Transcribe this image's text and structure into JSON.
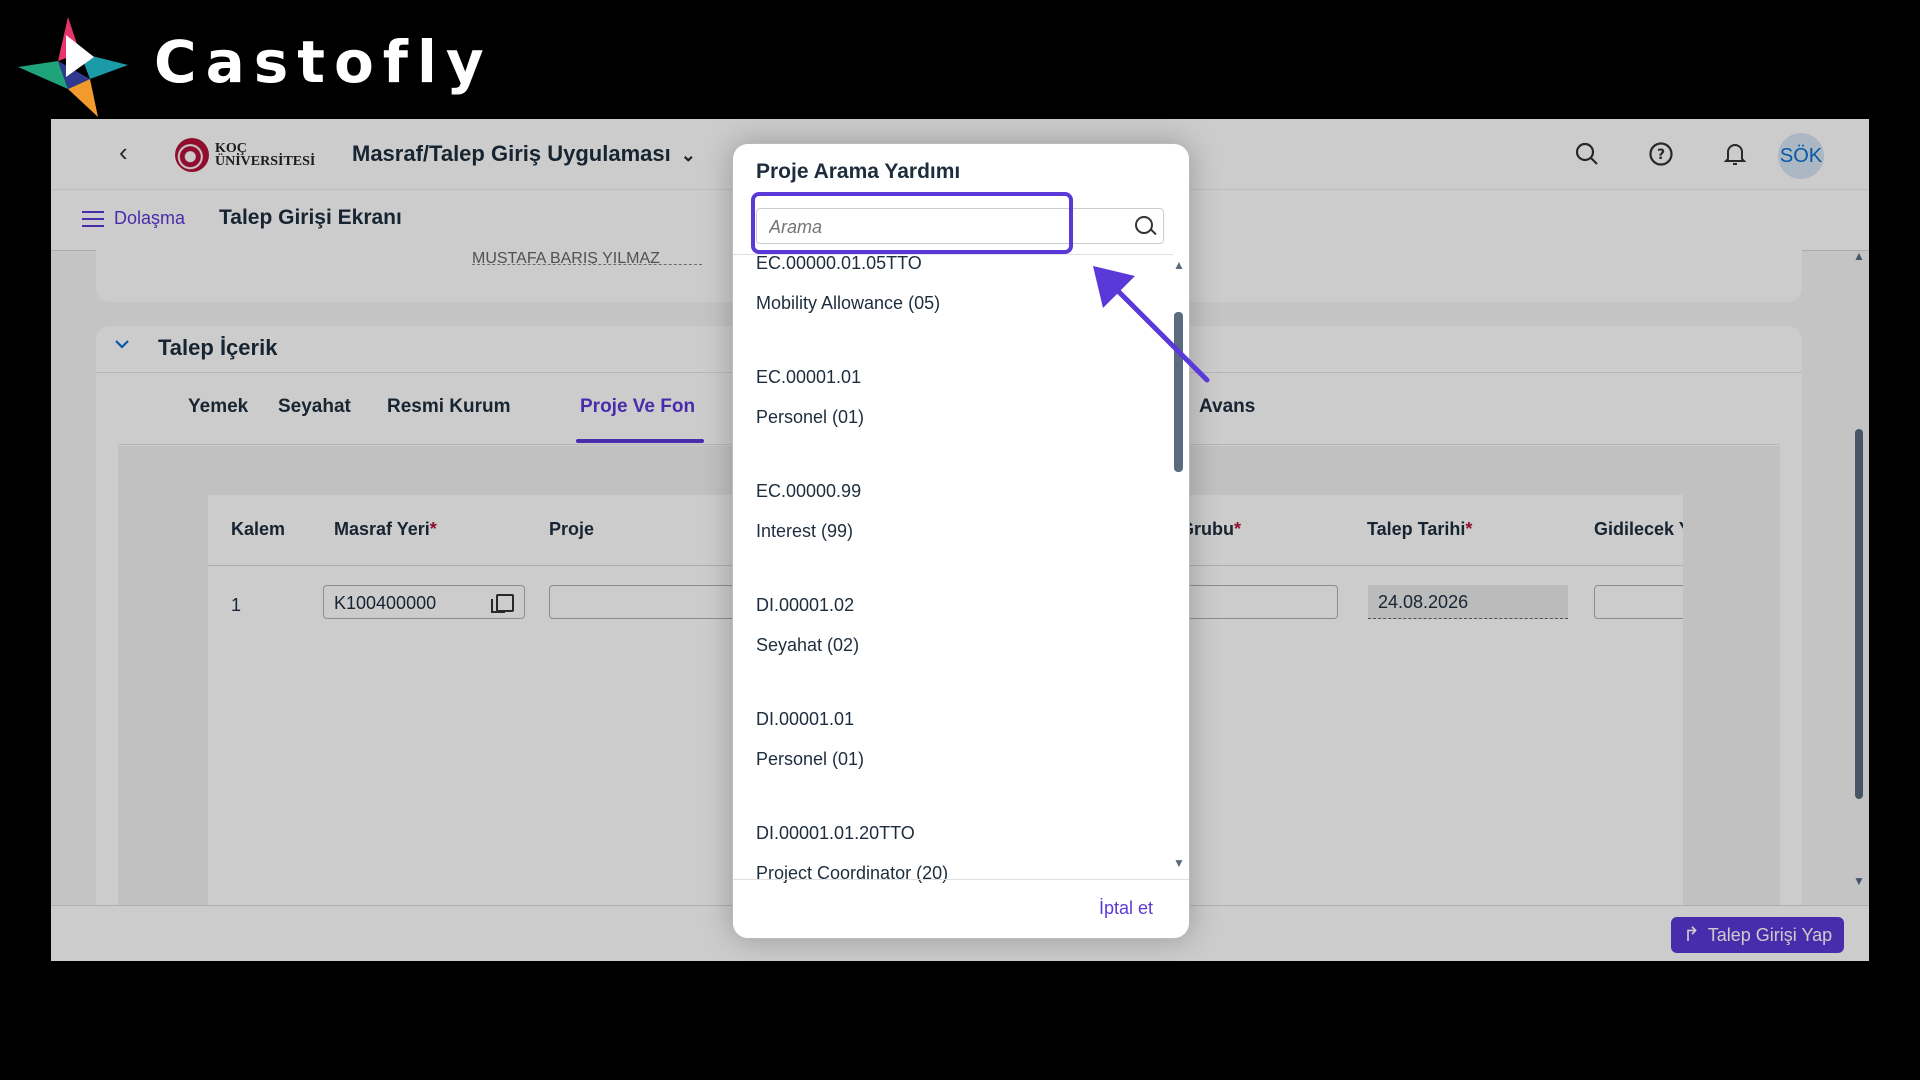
{
  "brand": {
    "name": "Castofly"
  },
  "header": {
    "logo_line1": "KOÇ",
    "logo_line2": "ÜNİVERSİTESİ",
    "app_title": "Masraf/Talep Giriş Uygulaması",
    "avatar_initials": "SÖK"
  },
  "subheader": {
    "nav_label": "Dolaşma",
    "page_title": "Talep Girişi Ekranı"
  },
  "section": {
    "title": "Talep İçerik",
    "ghost_text": "MUSTAFA BARIŞ YILMAZ (DİR...)",
    "tabs": [
      "Yemek",
      "Seyahat",
      "Resmi Kurum",
      "Proje Ve Fon",
      "Avans"
    ],
    "active_tab": "Proje Ve Fon"
  },
  "table": {
    "columns": [
      "Kalem",
      "Masraf Yeri",
      "Proje",
      "Grubu",
      "Talep Tarihi",
      "Gidilecek Y"
    ],
    "required_mark": "*",
    "row": {
      "kalem": "1",
      "masraf_yeri": "K100400000",
      "talep_tarihi": "24.08.2026"
    }
  },
  "footer": {
    "submit_label": "Talep Girişi Yap"
  },
  "modal": {
    "title": "Proje Arama Yardımı",
    "search_placeholder": "Arama",
    "items": [
      {
        "code": "EC.00000.01.05TTO",
        "name": "Mobility Allowance (05)"
      },
      {
        "code": "EC.00001.01",
        "name": "Personel (01)"
      },
      {
        "code": "EC.00000.99",
        "name": "Interest (99)"
      },
      {
        "code": "DI.00001.02",
        "name": "Seyahat (02)"
      },
      {
        "code": "DI.00001.01",
        "name": "Personel (01)"
      },
      {
        "code": "DI.00001.01.20TTO",
        "name": "Project Coordinator (20)"
      }
    ],
    "cancel_label": "İptal et"
  },
  "colors": {
    "accent": "#5b38d8",
    "brand_red": "#b3123a",
    "required": "#b3123a"
  }
}
